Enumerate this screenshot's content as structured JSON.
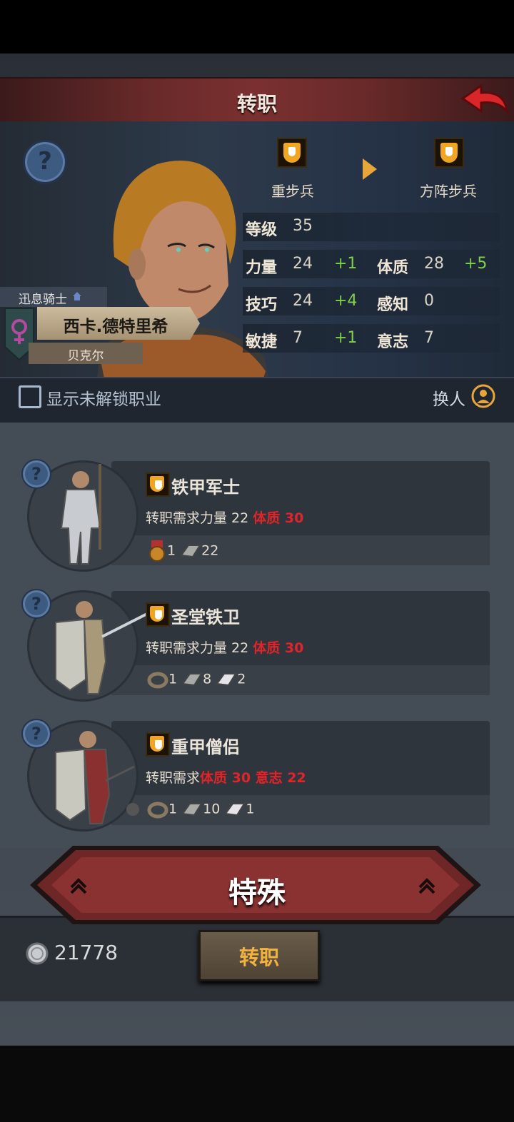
{
  "header": {
    "title": "转职"
  },
  "hero": {
    "title": "迅息骑士",
    "name": "西卡.德特里希",
    "place": "贝克尔",
    "from_class": "重步兵",
    "to_class": "方阵步兵",
    "level_label": "等级",
    "level_value": "35",
    "stats": {
      "str_label": "力量",
      "str_value": "24",
      "str_plus": "+1",
      "con_label": "体质",
      "con_value": "28",
      "con_plus": "+5",
      "skl_label": "技巧",
      "skl_value": "24",
      "skl_plus": "+4",
      "per_label": "感知",
      "per_value": "0",
      "agi_label": "敏捷",
      "agi_value": "7",
      "agi_plus": "+1",
      "wil_label": "意志",
      "wil_value": "7"
    },
    "colors": {
      "plus": "#7fd04a",
      "requirement_unmet": "#e0242a",
      "accent_gold": "#f2b240"
    }
  },
  "filter": {
    "show_locked_label": "显示未解锁职业",
    "swap_label": "换人"
  },
  "jobs": [
    {
      "name": "铁甲军士",
      "req_prefix": "转职需求",
      "req_ok": "力量 22",
      "req_bad": "体质 30",
      "costs": [
        {
          "icon": "medal-icon",
          "qty": "1"
        },
        {
          "icon": "iron-ingot-icon",
          "qty": "22"
        }
      ]
    },
    {
      "name": "圣堂铁卫",
      "req_prefix": "转职需求",
      "req_ok": "力量 22",
      "req_bad": "体质 30",
      "costs": [
        {
          "icon": "ring-icon",
          "qty": "1"
        },
        {
          "icon": "iron-ingot-icon",
          "qty": "8"
        },
        {
          "icon": "silver-ingot-icon",
          "qty": "2"
        }
      ]
    },
    {
      "name": "重甲僧侣",
      "req_prefix": "转职需求",
      "req_bad": "体质 30 意志 22",
      "costs": [
        {
          "icon": "ring-icon",
          "qty": "1"
        },
        {
          "icon": "iron-ingot-icon",
          "qty": "10"
        },
        {
          "icon": "silver-ingot-icon",
          "qty": "1"
        }
      ]
    }
  ],
  "category_button": {
    "label": "特殊"
  },
  "footer": {
    "coins": "21778",
    "confirm_label": "转职"
  }
}
